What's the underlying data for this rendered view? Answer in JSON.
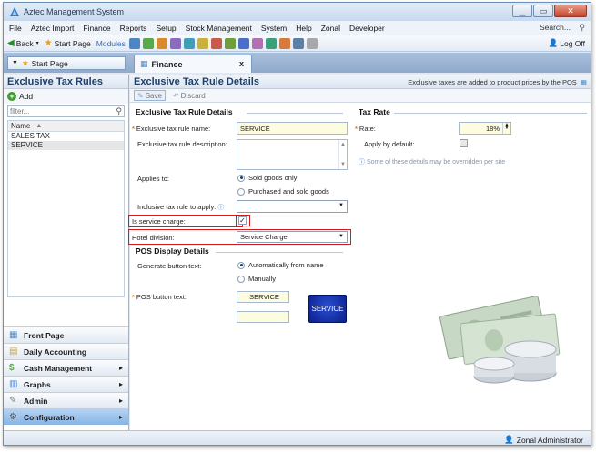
{
  "window": {
    "title": "Aztec Management System"
  },
  "menu": {
    "items": [
      "File",
      "Aztec Import",
      "Finance",
      "Reports",
      "Setup",
      "Stock Management",
      "System",
      "Help",
      "Zonal",
      "Developer"
    ],
    "search_label": "Search..."
  },
  "toolbar": {
    "back": "Back",
    "start_page": "Start Page",
    "modules": "Modules",
    "logoff": "Log Off"
  },
  "tabs": {
    "start_tab": "Start Page",
    "finance_tab": "Finance"
  },
  "left": {
    "title": "Exclusive Tax Rules",
    "add_label": "Add",
    "filter_placeholder": "filter...",
    "column_header": "Name",
    "items": [
      "SALES TAX",
      "SERVICE"
    ]
  },
  "nav": {
    "front_page": "Front Page",
    "daily_accounting": "Daily Accounting",
    "cash_management": "Cash Management",
    "graphs": "Graphs",
    "admin": "Admin",
    "configuration": "Configuration"
  },
  "content": {
    "title": "Exclusive Tax Rule Details",
    "info": "Exclusive taxes are added to product prices by the POS",
    "save": "Save",
    "discard": "Discard"
  },
  "details": {
    "group_title": "Exclusive Tax Rule Details",
    "name_label": "Exclusive tax rule name:",
    "name_value": "SERVICE",
    "description_label": "Exclusive tax rule description:",
    "description_value": "",
    "applies_label": "Applies to:",
    "applies_opt1": "Sold goods only",
    "applies_opt2": "Purchased and sold goods",
    "inclusive_label": "Inclusive tax rule to apply:",
    "inclusive_value": "",
    "service_charge_label": "Is service charge:",
    "hotel_division_label": "Hotel division:",
    "hotel_division_value": "Service Charge"
  },
  "tax_rate": {
    "group_title": "Tax Rate",
    "rate_label": "Rate:",
    "rate_value": "18%",
    "apply_default_label": "Apply by default:",
    "note": "Some of these details may be overridden per site"
  },
  "pos": {
    "group_title": "POS Display Details",
    "generate_label": "Generate button text:",
    "opt_auto": "Automatically from name",
    "opt_manual": "Manually",
    "button_text_label": "POS button text:",
    "button_text_value": "SERVICE",
    "button_text_line2": "",
    "preview_label": "SERVICE"
  },
  "status": {
    "user": "Zonal Administrator"
  },
  "colors": {
    "accent": "#1e3f6b",
    "highlight": "#d31b1b",
    "pos_button": "#1533b4"
  }
}
